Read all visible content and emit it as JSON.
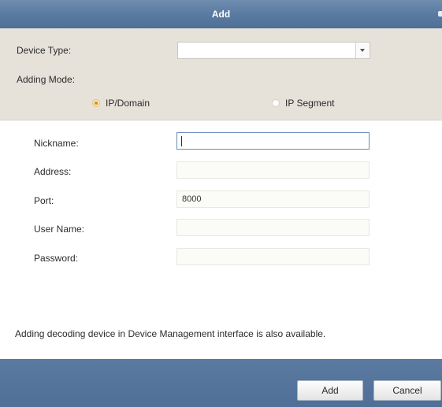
{
  "window": {
    "title": "Add"
  },
  "device": {
    "type_label": "Device Type:",
    "type_value": "",
    "adding_mode_label": "Adding Mode:",
    "modes": [
      {
        "label": "IP/Domain",
        "checked": true
      },
      {
        "label": "IP Segment",
        "checked": false
      }
    ]
  },
  "form": {
    "nickname": {
      "label": "Nickname:",
      "value": ""
    },
    "address": {
      "label": "Address:",
      "value": ""
    },
    "port": {
      "label": "Port:",
      "value": "8000"
    },
    "username": {
      "label": "User Name:",
      "value": ""
    },
    "password": {
      "label": "Password:",
      "value": ""
    }
  },
  "note": "Adding decoding device in Device Management interface is also available.",
  "buttons": {
    "add": "Add",
    "cancel": "Cancel"
  },
  "colors": {
    "titlebar": "#5879a0",
    "panel": "#e6e2da",
    "accent_radio": "#d98a1c",
    "focus_border": "#6a8bb8"
  }
}
